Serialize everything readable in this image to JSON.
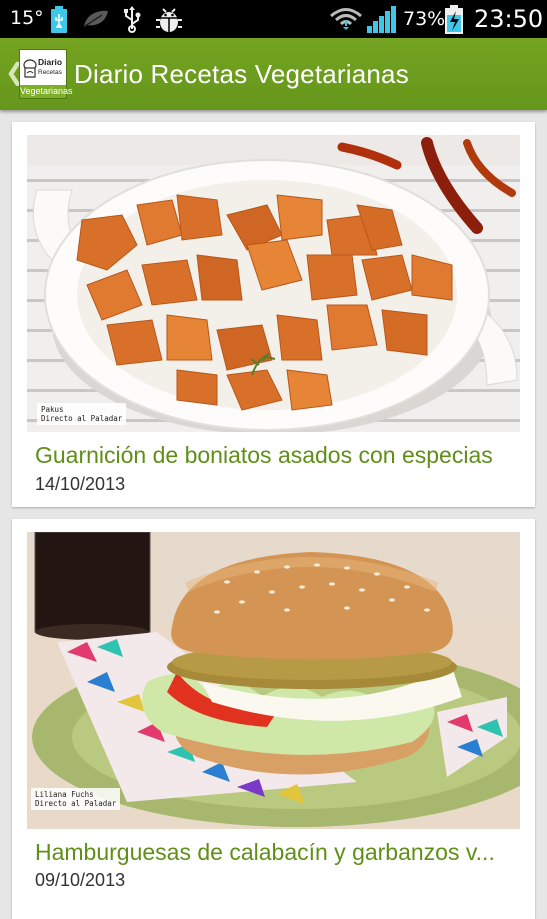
{
  "status_bar": {
    "temperature": "15°",
    "battery_percent": "73%",
    "time": "23:50",
    "icons": [
      "usb-battery-icon",
      "leaf-icon",
      "usb-icon",
      "android-debug-icon",
      "wifi-icon",
      "signal-icon",
      "battery-charging-icon"
    ]
  },
  "action_bar": {
    "back_glyph": "❮",
    "title": "Diario Recetas Vegetarianas",
    "logo": {
      "line1": "Diario",
      "line2": "Recetas",
      "band": "Vegetarianas"
    },
    "color": "#6b9c1d"
  },
  "articles": [
    {
      "title": "Guarnición de boniatos asados con especias",
      "date": "14/10/2013",
      "photo_credit": {
        "line1": "Pakus",
        "line2": "Directo al Paladar"
      }
    },
    {
      "title": "Hamburguesas de calabacín y garbanzos v...",
      "date": "09/10/2013",
      "photo_credit": {
        "line1": "Liliana Fuchs",
        "line2": "Directo al Paladar"
      }
    }
  ],
  "colors": {
    "accent_green": "#5f8f17",
    "background": "#e6e6e6"
  }
}
